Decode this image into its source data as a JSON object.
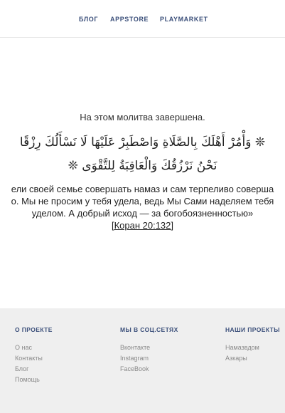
{
  "nav": {
    "items": [
      {
        "label": "БЛОГ"
      },
      {
        "label": "APPSTORE"
      },
      {
        "label": "PLAYMARKET"
      }
    ]
  },
  "main": {
    "done_text": "На этом молитва завершена.",
    "arabic_line1": "❊ وَأْمُرْ أَهْلَكَ بِالصَّلَاةِ وَاصْطَبِرْ عَلَيْهَا لَا نَسْأَلُكَ رِزْقًا",
    "arabic_line2": "نَحْنُ نَرْزُقُكَ وَالْعَاقِبَةُ لِلتَّقْوَى ❊",
    "translation_line1": "ели своей семье совершать намаз и сам терпеливо соверша",
    "translation_line2": "о. Мы не просим у тебя удела, ведь Мы Сами наделяем тебя",
    "translation_line3": "уделом. А добрый исход — за богобоязненностью»",
    "reference": "[Коран 20:132]"
  },
  "footer": {
    "about": {
      "title": "О ПРОЕКТЕ",
      "links": [
        "О нас",
        "Контакты",
        "Блог",
        "Помощь"
      ]
    },
    "social": {
      "title": "МЫ В СОЦ.СЕТЯХ",
      "links": [
        "Вконтакте",
        "Instagram",
        "FaceBook"
      ]
    },
    "projects": {
      "title": "НАШИ ПРОЕКТЫ",
      "links": [
        "Намазвдом",
        "Азкары"
      ]
    }
  }
}
